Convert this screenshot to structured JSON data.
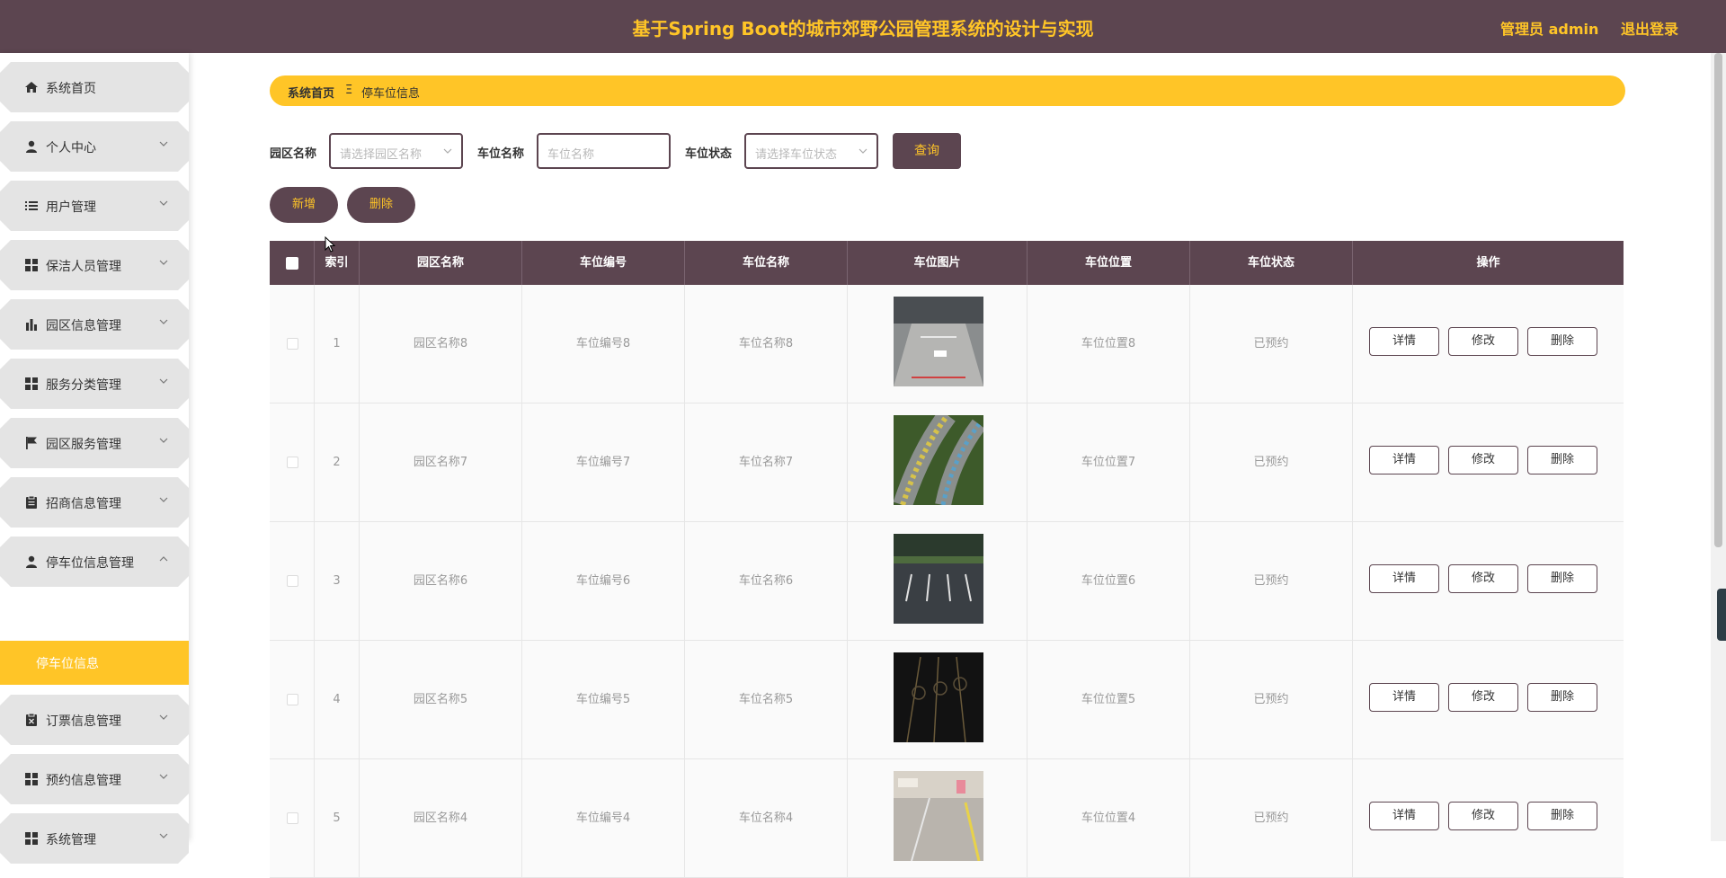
{
  "header": {
    "title": "基于Spring Boot的城市郊野公园管理系统的设计与实现",
    "user": "管理员 admin",
    "logout": "退出登录"
  },
  "sidebar": {
    "items": [
      {
        "label": "系统首页",
        "icon": "home-icon"
      },
      {
        "label": "个人中心",
        "icon": "person-icon"
      },
      {
        "label": "用户管理",
        "icon": "list-icon"
      },
      {
        "label": "保洁人员管理",
        "icon": "grid-icon"
      },
      {
        "label": "园区信息管理",
        "icon": "bar-chart-icon"
      },
      {
        "label": "服务分类管理",
        "icon": "grid-icon"
      },
      {
        "label": "园区服务管理",
        "icon": "flag-icon"
      },
      {
        "label": "招商信息管理",
        "icon": "clipboard-icon"
      },
      {
        "label": "停车位信息管理",
        "icon": "person-icon"
      },
      {
        "label": "订票信息管理",
        "icon": "clipboard-x-icon"
      },
      {
        "label": "预约信息管理",
        "icon": "grid-icon"
      },
      {
        "label": "系统管理",
        "icon": "grid-icon"
      }
    ],
    "sub_item": "停车位信息"
  },
  "breadcrumb": {
    "home": "系统首页",
    "separator": "Ξ",
    "current": "停车位信息"
  },
  "search": {
    "park_label": "园区名称",
    "park_placeholder": "请选择园区名称",
    "space_label": "车位名称",
    "space_placeholder": "车位名称",
    "status_label": "车位状态",
    "status_placeholder": "请选择车位状态",
    "query": "查询"
  },
  "actions": {
    "add": "新增",
    "delete": "删除"
  },
  "table": {
    "columns": [
      "索引",
      "园区名称",
      "车位编号",
      "车位名称",
      "车位图片",
      "车位位置",
      "车位状态",
      "操作"
    ],
    "rows": [
      {
        "index": "1",
        "park": "园区名称8",
        "code": "车位编号8",
        "name": "车位名称8",
        "position": "车位位置8",
        "status": "已预约"
      },
      {
        "index": "2",
        "park": "园区名称7",
        "code": "车位编号7",
        "name": "车位名称7",
        "position": "车位位置7",
        "status": "已预约"
      },
      {
        "index": "3",
        "park": "园区名称6",
        "code": "车位编号6",
        "name": "车位名称6",
        "position": "车位位置6",
        "status": "已预约"
      },
      {
        "index": "4",
        "park": "园区名称5",
        "code": "车位编号5",
        "name": "车位名称5",
        "position": "车位位置5",
        "status": "已预约"
      },
      {
        "index": "5",
        "park": "园区名称4",
        "code": "车位编号4",
        "name": "车位名称4",
        "position": "车位位置4",
        "status": "已预约"
      }
    ],
    "row_actions": {
      "detail": "详情",
      "edit": "修改",
      "delete": "删除"
    }
  },
  "colors": {
    "primary": "#5c4550",
    "accent": "#ffc527"
  }
}
